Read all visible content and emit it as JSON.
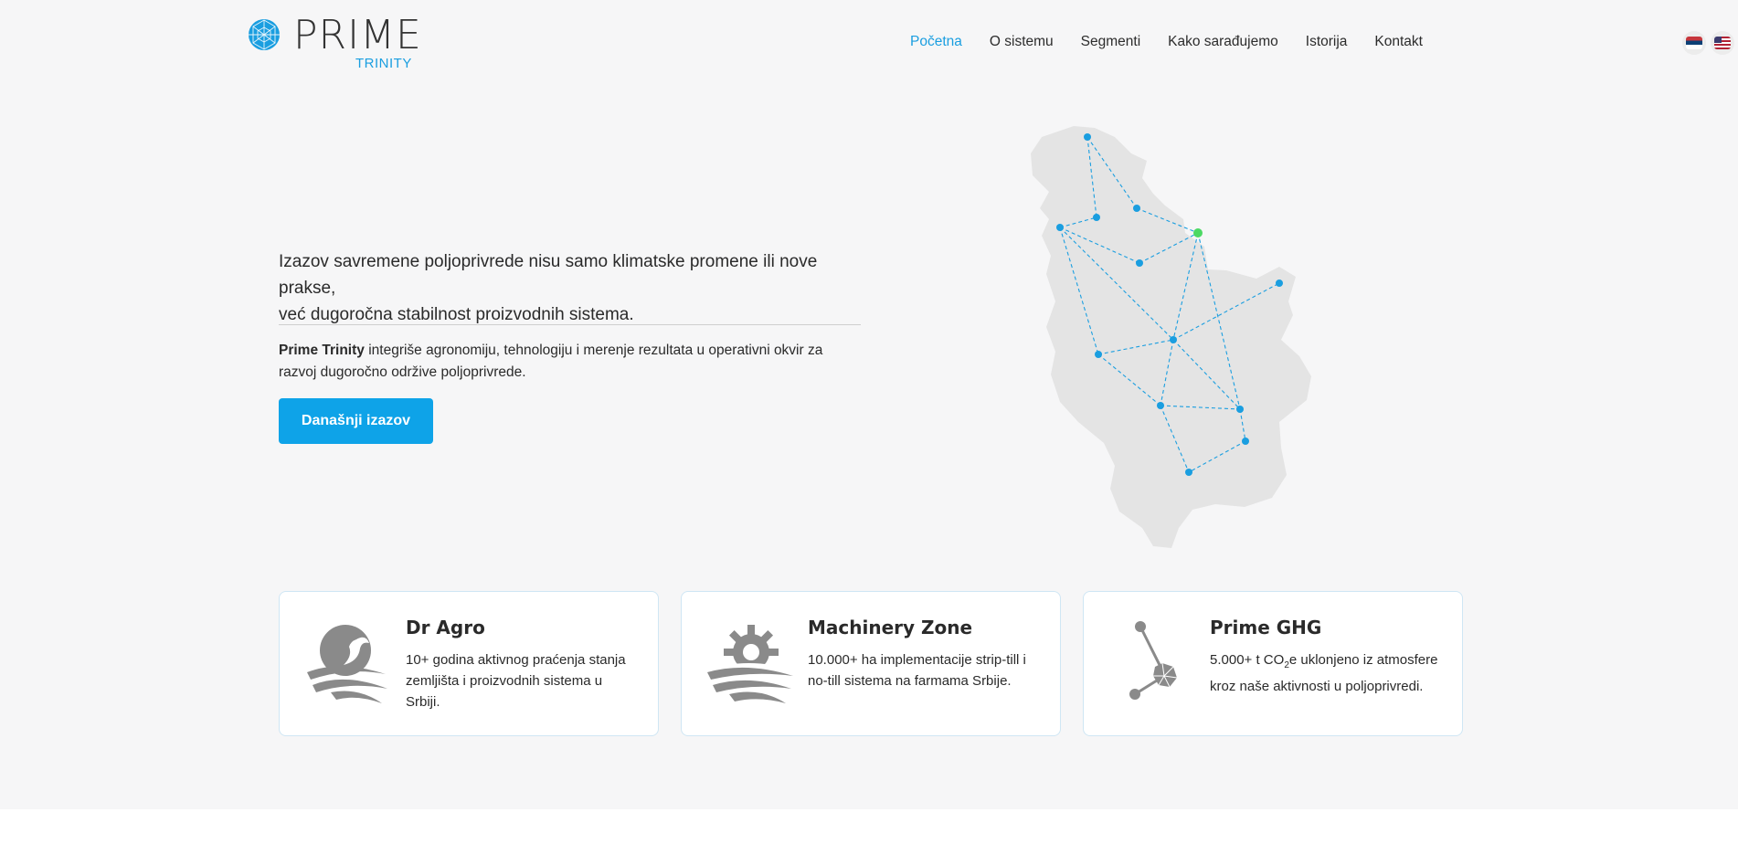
{
  "header": {
    "logo": {
      "primary": "PRIME",
      "secondary": "TRINITY"
    },
    "nav": [
      {
        "label": "Početna",
        "active": true
      },
      {
        "label": "O sistemu",
        "active": false
      },
      {
        "label": "Segmenti",
        "active": false
      },
      {
        "label": "Kako sarađujemo",
        "active": false
      },
      {
        "label": "Istorija",
        "active": false
      },
      {
        "label": "Kontakt",
        "active": false
      }
    ],
    "languages": [
      "serbian-flag-icon",
      "us-flag-icon"
    ]
  },
  "hero": {
    "lead_line1": "Izazov savremene poljoprivrede nisu samo klimatske promene ili nove prakse,",
    "lead_line2": "već dugoročna stabilnost proizvodnih sistema.",
    "body_strong": "Prime Trinity",
    "body_rest": " integriše agronomiju, tehnologiju i merenje rezultata u operativni okvir za razvoj dugoročno održive poljoprivrede.",
    "cta_label": "Današnji izazov"
  },
  "cards": [
    {
      "icon": "farm-bird-icon",
      "title": "Dr Agro",
      "desc": "10+ godina aktivnog praćenja stanja zemljišta i proizvodnih sistema u Srbiji."
    },
    {
      "icon": "gear-field-icon",
      "title": "Machinery Zone",
      "desc": "10.000+ ha implementacije strip-till i no-till sistema na farmama Srbije."
    },
    {
      "icon": "carbon-molecule-icon",
      "title": "Prime GHG",
      "desc_pre": "5.000+ t CO",
      "desc_sub": "2",
      "desc_post": "e uklonjeno iz atmosfere kroz naše aktivnosti u poljoprivredi."
    }
  ],
  "colors": {
    "accent": "#1a9ee0",
    "button": "#0ea3e8",
    "highlight_node": "#4cd964",
    "icon_grey": "#8a8a8a"
  }
}
